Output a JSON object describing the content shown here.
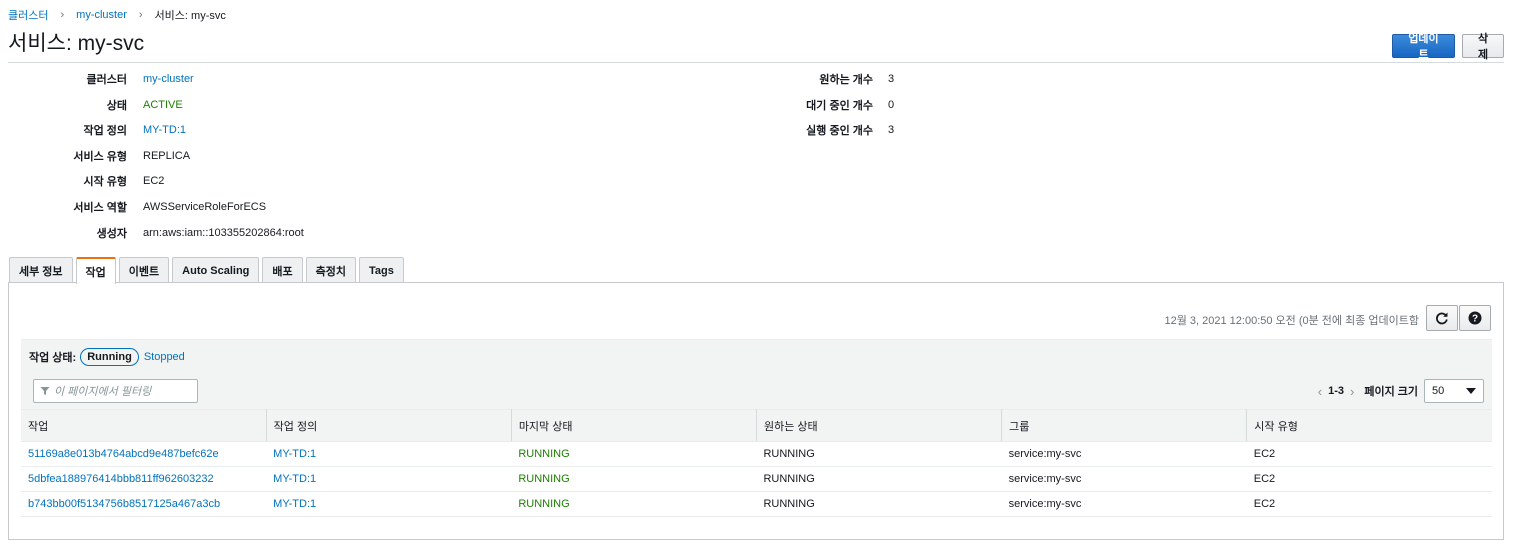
{
  "breadcrumb": {
    "root": "클러스터",
    "cluster": "my-cluster",
    "current": "서비스: my-svc"
  },
  "title": "서비스: my-svc",
  "actions": {
    "update": "업데이트",
    "delete": "삭제"
  },
  "details_left": [
    {
      "label": "클러스터",
      "value": "my-cluster",
      "style": "link"
    },
    {
      "label": "상태",
      "value": "ACTIVE",
      "style": "active"
    },
    {
      "label": "작업 정의",
      "value": "MY-TD:1",
      "style": "link"
    },
    {
      "label": "서비스 유형",
      "value": "REPLICA",
      "style": "plain"
    },
    {
      "label": "시작 유형",
      "value": "EC2",
      "style": "plain"
    },
    {
      "label": "서비스 역할",
      "value": "AWSServiceRoleForECS",
      "style": "plain"
    },
    {
      "label": "생성자",
      "value": "arn:aws:iam::103355202864:root",
      "style": "plain"
    }
  ],
  "details_right": [
    {
      "label": "원하는 개수",
      "value": "3"
    },
    {
      "label": "대기 중인 개수",
      "value": "0"
    },
    {
      "label": "실행 중인 개수",
      "value": "3"
    }
  ],
  "tabs": [
    {
      "label": "세부 정보",
      "active": false
    },
    {
      "label": "작업",
      "active": true
    },
    {
      "label": "이벤트",
      "active": false
    },
    {
      "label": "Auto Scaling",
      "active": false
    },
    {
      "label": "배포",
      "active": false
    },
    {
      "label": "측정치",
      "active": false
    },
    {
      "label": "Tags",
      "active": false
    }
  ],
  "last_updated": "12월 3, 2021 12:00:50 오전 (0분 전에 최종 업데이트함",
  "task_status": {
    "label": "작업 상태:",
    "running": "Running",
    "stopped": "Stopped"
  },
  "filter": {
    "placeholder": "이 페이지에서 필터링"
  },
  "pager": {
    "range": "1-3",
    "size_label": "페이지 크기",
    "size": "50"
  },
  "table": {
    "headers": [
      "작업",
      "작업 정의",
      "마지막 상태",
      "원하는 상태",
      "그룹",
      "시작 유형"
    ],
    "rows": [
      [
        "51169a8e013b4764abcd9e487befc62e",
        "MY-TD:1",
        "RUNNING",
        "RUNNING",
        "service:my-svc",
        "EC2"
      ],
      [
        "5dbfea188976414bbb811ff962603232",
        "MY-TD:1",
        "RUNNING",
        "RUNNING",
        "service:my-svc",
        "EC2"
      ],
      [
        "b743bb00f5134756b8517125a467a3cb",
        "MY-TD:1",
        "RUNNING",
        "RUNNING",
        "service:my-svc",
        "EC2"
      ]
    ]
  },
  "colors": {
    "link": "#0073bb",
    "success": "#1d8102",
    "primary": "#1666c3",
    "tab_accent": "#ec7211"
  },
  "icons": {
    "refresh": "refresh-icon",
    "help": "help-icon",
    "filter": "filter-icon",
    "dropdown": "caret-down-icon"
  }
}
